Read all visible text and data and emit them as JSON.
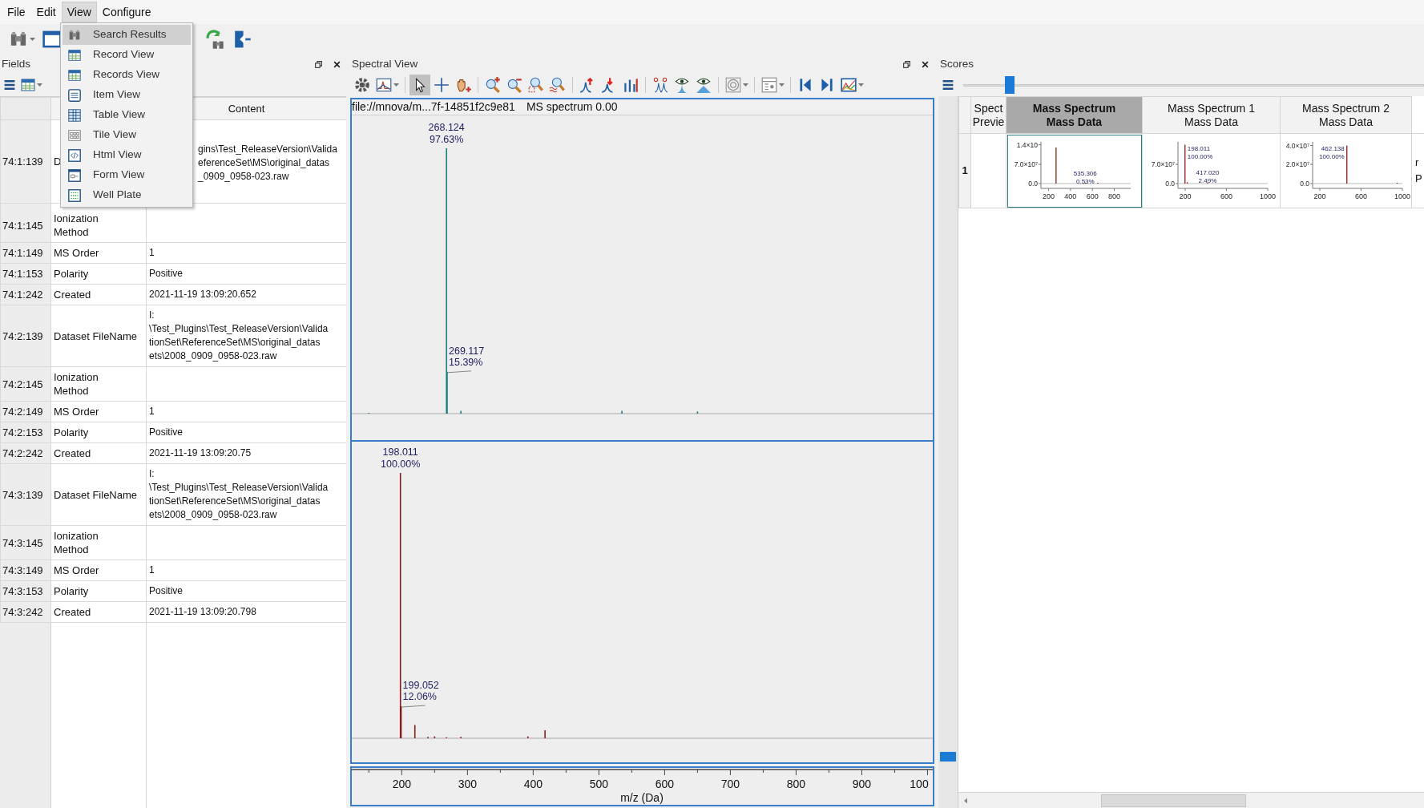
{
  "menubar": [
    {
      "label": "File",
      "selected": false
    },
    {
      "label": "Edit",
      "selected": false
    },
    {
      "label": "View",
      "selected": true
    },
    {
      "label": "Configure",
      "selected": false
    }
  ],
  "toolbar": {
    "tools": [
      {
        "dropdown": true
      },
      {
        "dropdown": false
      },
      {
        "dropdown": false
      },
      {
        "dropdown": false
      }
    ]
  },
  "view_menu": {
    "items": [
      {
        "label": "Search Results",
        "selected": true
      },
      {
        "label": "Record View",
        "selected": false
      },
      {
        "label": "Records View",
        "selected": false
      },
      {
        "label": "Item View",
        "selected": false
      },
      {
        "label": "Table View",
        "selected": false
      },
      {
        "label": "Tile View",
        "selected": false
      },
      {
        "label": "Html View",
        "selected": false
      },
      {
        "label": "Form View",
        "selected": false
      },
      {
        "label": "Well Plate",
        "selected": false
      }
    ]
  },
  "fields_panel": {
    "title": "Fields",
    "content_header": "Content",
    "rows": [
      {
        "id": "74:1:139",
        "field": "D",
        "content": "gins\\Test_ReleaseVersion\\Valida\neferenceSet\\MS\\original_datas\n_0909_0958-023.raw"
      },
      {
        "id": "74:1:145",
        "field": "Ionization\nMethod"
      },
      {
        "id": "74:1:149",
        "field": "MS Order",
        "content": "1"
      },
      {
        "id": "74:1:153",
        "field": "Polarity",
        "content": "Positive"
      },
      {
        "id": "74:1:242",
        "field": "Created",
        "content": "2021-11-19 13:09:20.652"
      },
      {
        "id": "74:2:139",
        "field": "Dataset FileName",
        "content": "I:\n\\Test_Plugins\\Test_ReleaseVersion\\Valida\ntionSet\\ReferenceSet\\MS\\original_datas\nets\\2008_0909_0958-023.raw"
      },
      {
        "id": "74:2:145",
        "field": "Ionization\nMethod"
      },
      {
        "id": "74:2:149",
        "field": "MS Order",
        "content": "1"
      },
      {
        "id": "74:2:153",
        "field": "Polarity",
        "content": "Positive"
      },
      {
        "id": "74:2:242",
        "field": "Created",
        "content": "2021-11-19 13:09:20.75"
      },
      {
        "id": "74:3:139",
        "field": "Dataset FileName",
        "content": "I:\n\\Test_Plugins\\Test_ReleaseVersion\\Valida\ntionSet\\ReferenceSet\\MS\\original_datas\nets\\2008_0909_0958-023.raw"
      },
      {
        "id": "74:3:145",
        "field": "Ionization\nMethod"
      },
      {
        "id": "74:3:149",
        "field": "MS Order",
        "content": "1"
      },
      {
        "id": "74:3:153",
        "field": "Polarity",
        "content": "Positive"
      },
      {
        "id": "74:3:242",
        "field": "Created",
        "content": "2021-11-19 13:09:20.798"
      }
    ]
  },
  "spectral_view": {
    "title": "Spectral View",
    "path": "file://mnova/m...7f-14851f2c9e81",
    "caption": "MS spectrum 0.00",
    "tools": [
      {
        "selected": false,
        "dropdown": false
      },
      {
        "selected": false,
        "dropdown": true
      },
      {
        "selected": true,
        "dropdown": false
      },
      {
        "selected": false,
        "dropdown": false
      },
      {
        "selected": false,
        "dropdown": false
      },
      {
        "selected": false,
        "dropdown": false
      },
      {
        "selected": false,
        "dropdown": false
      },
      {
        "selected": false,
        "dropdown": false
      },
      {
        "selected": false,
        "dropdown": false
      },
      {
        "selected": false,
        "dropdown": false
      },
      {
        "selected": false,
        "dropdown": false
      },
      {
        "selected": false,
        "dropdown": false
      },
      {
        "selected": false,
        "dropdown": false
      },
      {
        "selected": false,
        "dropdown": false
      },
      {
        "selected": false,
        "dropdown": false
      },
      {
        "selected": false,
        "dropdown": true
      },
      {
        "selected": false,
        "dropdown": true
      },
      {
        "selected": false,
        "dropdown": false
      },
      {
        "selected": false,
        "dropdown": false
      },
      {
        "selected": false,
        "dropdown": true
      }
    ],
    "spectra": [
      {
        "color": "#1b7f80",
        "peak_labels": [
          {
            "mz": "268.124",
            "intensity": "97.63%"
          },
          {
            "mz": "269.117",
            "intensity": "15.39%"
          }
        ]
      },
      {
        "color": "#8b1c1c",
        "peak_labels": [
          {
            "mz": "198.011",
            "intensity": "100.00%"
          },
          {
            "mz": "199.052",
            "intensity": "12.06%"
          }
        ]
      }
    ],
    "x_axis": {
      "ticks": [
        "200",
        "300",
        "400",
        "500",
        "600",
        "700",
        "800",
        "900",
        "100"
      ],
      "title": "m/z (Da)"
    }
  },
  "scores_panel": {
    "title": "Scores",
    "zoom_slider": {
      "level": 0.09
    },
    "columns": [
      {
        "header": "Spect\nPrevie",
        "selected": false
      },
      {
        "header": "Mass Spectrum\nMass Data",
        "selected": true
      },
      {
        "header": "Mass Spectrum 1\nMass Data",
        "selected": false
      },
      {
        "header": "Mass Spectrum 2\nMass Data",
        "selected": false
      }
    ],
    "rows": [
      {
        "header": "1",
        "cells": [
          {
            "kind": "blank"
          },
          {
            "kind": "thumbnail",
            "selected": true,
            "y_labels": [
              "1.4×10",
              "7.0×10⁷",
              "0.0"
            ],
            "x_labels": [
              "200",
              "400",
              "600",
              "800"
            ],
            "peak_labels": [
              {
                "mz": "535.306",
                "intensity": "0.53%"
              }
            ]
          },
          {
            "kind": "thumbnail",
            "selected": false,
            "y_labels": [
              "7.0×10⁷",
              "0.0"
            ],
            "x_labels": [
              "200",
              "600",
              "1000"
            ],
            "peak_labels": [
              {
                "mz": "198.011",
                "intensity": "100.00%"
              },
              {
                "mz": "417.020",
                "intensity": "2.49%"
              }
            ]
          },
          {
            "kind": "thumbnail",
            "selected": false,
            "y_labels": [
              "4.0×10⁷",
              "2.0×10⁷",
              "0.0"
            ],
            "x_labels": [
              "200",
              "600",
              "1000"
            ],
            "peak_labels": [
              {
                "mz": "462.138",
                "intensity": "100.00%"
              }
            ]
          },
          {
            "kind": "text",
            "text": "r\nP"
          }
        ]
      }
    ]
  }
}
